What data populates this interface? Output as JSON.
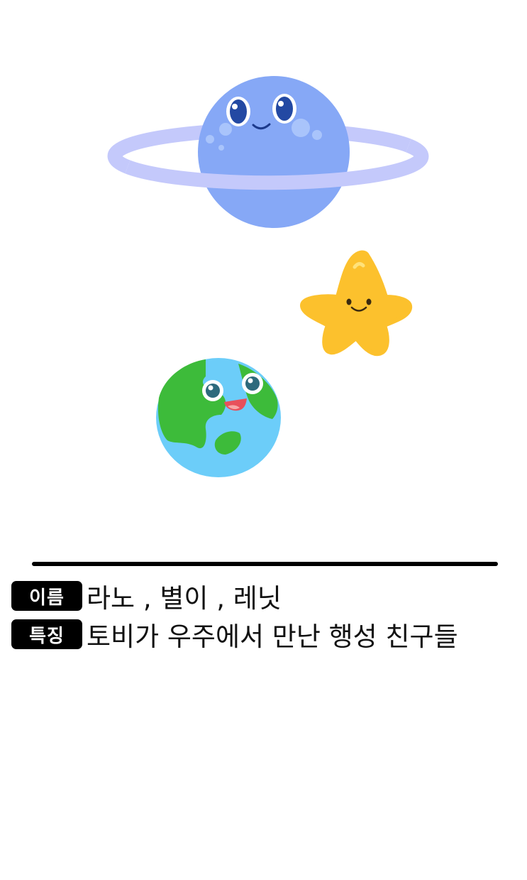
{
  "characters": [
    {
      "id": "planet",
      "icon": "ringed-planet-icon",
      "color": "#86a8f6"
    },
    {
      "id": "star",
      "icon": "star-icon",
      "color": "#fcc12d"
    },
    {
      "id": "earth",
      "icon": "earth-icon",
      "color": "#6ccdf9"
    }
  ],
  "info": {
    "name_label": "이름",
    "name_value": "라노 , 별이 , 레닛",
    "trait_label": "특징",
    "trait_value": "토비가 우주에서 만난 행성 친구들"
  },
  "colors": {
    "badge_bg": "#000000",
    "badge_text": "#ffffff",
    "divider": "#000000"
  }
}
